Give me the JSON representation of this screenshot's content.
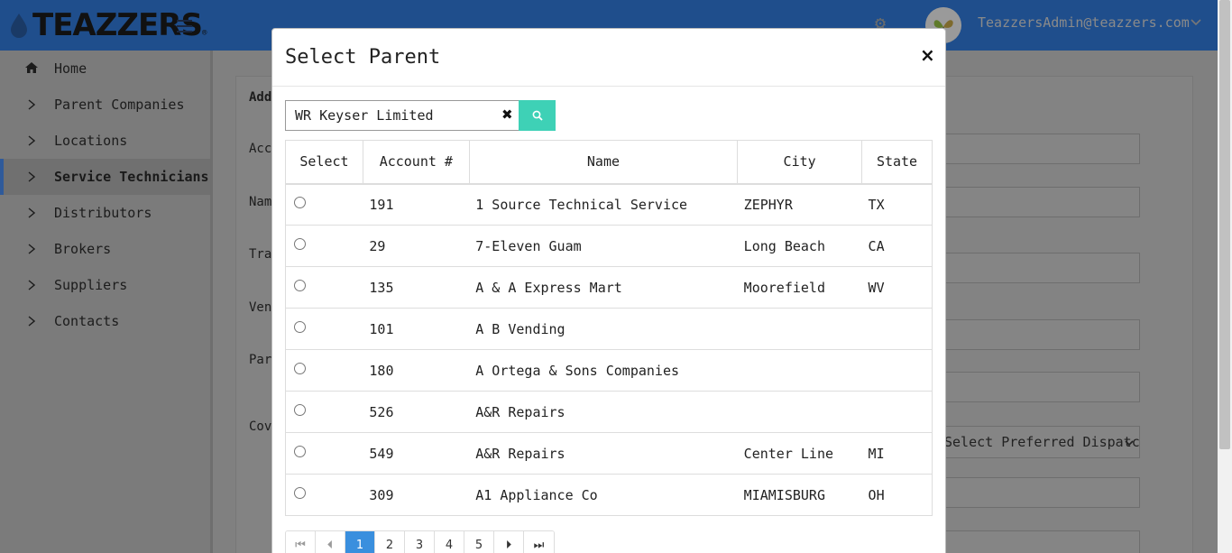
{
  "header": {
    "brand": "TEAZZERS",
    "trademark": "®",
    "user_email": "TeazzersAdmin@teazzers.com",
    "icons": {
      "menu": "hamburger-icon",
      "settings": "gear-icon",
      "dropdown": "chevron-down-icon"
    }
  },
  "sidebar": {
    "items": [
      {
        "label": "Home",
        "icon": "home-icon"
      },
      {
        "label": "Parent Companies",
        "icon": "chevron-right-icon"
      },
      {
        "label": "Locations",
        "icon": "chevron-right-icon"
      },
      {
        "label": "Service Technicians",
        "icon": "chevron-right-icon",
        "active": true
      },
      {
        "label": "Distributors",
        "icon": "chevron-right-icon"
      },
      {
        "label": "Brokers",
        "icon": "chevron-right-icon"
      },
      {
        "label": "Suppliers",
        "icon": "chevron-right-icon"
      },
      {
        "label": "Contacts",
        "icon": "chevron-right-icon"
      }
    ]
  },
  "background_form": {
    "labels": [
      "Add",
      "Acc",
      "Nam",
      "Tra",
      "Ven",
      "Par",
      "Cov"
    ],
    "preferred_dispatch_select": "Select Preferred Dispatcher"
  },
  "modal": {
    "title": "Select Parent",
    "close_label": "×",
    "search": {
      "value": "WR Keyser Limited",
      "clear_label": "✖"
    },
    "columns": [
      "Select",
      "Account #",
      "Name",
      "City",
      "State"
    ],
    "rows": [
      {
        "account": "191",
        "name": "1 Source Technical Service",
        "city": "ZEPHYR",
        "state": "TX"
      },
      {
        "account": "29",
        "name": "7-Eleven Guam",
        "city": "Long Beach",
        "state": "CA"
      },
      {
        "account": "135",
        "name": "A & A Express Mart",
        "city": "Moorefield",
        "state": "WV"
      },
      {
        "account": "101",
        "name": "A B Vending",
        "city": "",
        "state": ""
      },
      {
        "account": "180",
        "name": "A Ortega & Sons Companies",
        "city": "",
        "state": ""
      },
      {
        "account": "526",
        "name": "A&R Repairs",
        "city": "",
        "state": ""
      },
      {
        "account": "549",
        "name": "A&R Repairs",
        "city": "Center Line",
        "state": "MI"
      },
      {
        "account": "309",
        "name": "A1 Appliance Co",
        "city": "MIAMISBURG",
        "state": "OH"
      }
    ],
    "pagination": {
      "first_label": "⏮",
      "prev_label": "⏴",
      "next_label": "⏵",
      "last_label": "⏭",
      "pages": [
        "1",
        "2",
        "3",
        "4",
        "5"
      ],
      "current": "1"
    }
  },
  "colors": {
    "topbar": "#1f4e8c",
    "search_button": "#3ed1b6",
    "active_page": "#3a8fde"
  }
}
